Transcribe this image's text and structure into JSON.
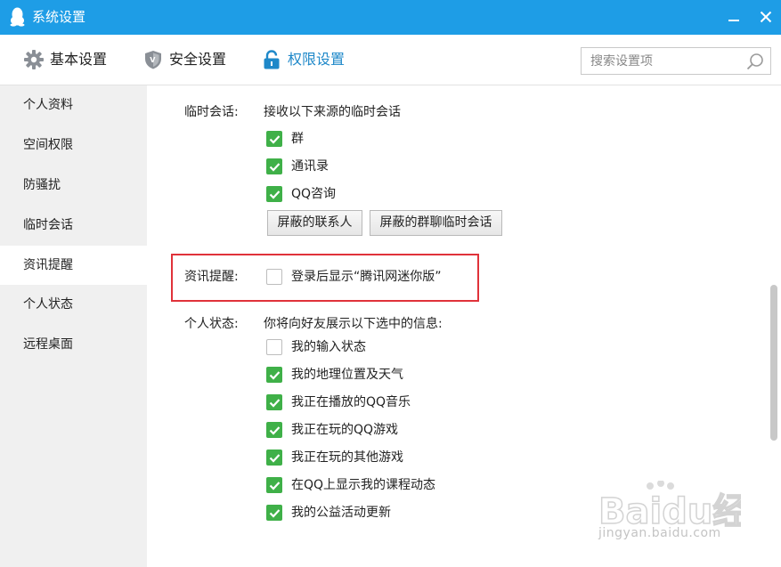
{
  "window": {
    "title": "系统设置",
    "minimize_glyph": "─",
    "close_glyph": "✕"
  },
  "tabs": [
    {
      "label": "基本设置",
      "icon": "gear-icon",
      "active": false
    },
    {
      "label": "安全设置",
      "icon": "shield-icon",
      "active": false
    },
    {
      "label": "权限设置",
      "icon": "lock-icon",
      "active": true
    }
  ],
  "search": {
    "placeholder": "搜索设置项",
    "value": ""
  },
  "sidebar": {
    "items": [
      {
        "label": "个人资料",
        "active": false
      },
      {
        "label": "空间权限",
        "active": false
      },
      {
        "label": "防骚扰",
        "active": false
      },
      {
        "label": "临时会话",
        "active": false
      },
      {
        "label": "资讯提醒",
        "active": true
      },
      {
        "label": "个人状态",
        "active": false
      },
      {
        "label": "远程桌面",
        "active": false
      }
    ]
  },
  "temp_chat": {
    "label": "临时会话:",
    "description": "接收以下来源的临时会话",
    "options": [
      {
        "label": "群",
        "checked": true
      },
      {
        "label": "通讯录",
        "checked": true
      },
      {
        "label": "QQ咨询",
        "checked": true
      }
    ],
    "buttons": {
      "blocked_contacts": "屏蔽的联系人",
      "blocked_group_chats": "屏蔽的群聊临时会话"
    }
  },
  "news_alert": {
    "label": "资讯提醒:",
    "option": {
      "label": "登录后显示“腾讯网迷你版”",
      "checked": false
    }
  },
  "personal_status": {
    "label": "个人状态:",
    "description": "你将向好友展示以下选中的信息:",
    "options": [
      {
        "label": "我的输入状态",
        "checked": false
      },
      {
        "label": "我的地理位置及天气",
        "checked": true
      },
      {
        "label": "我正在播放的QQ音乐",
        "checked": true
      },
      {
        "label": "我正在玩的QQ游戏",
        "checked": true
      },
      {
        "label": "我正在玩的其他游戏",
        "checked": true
      },
      {
        "label": "在QQ上显示我的课程动态",
        "checked": true
      },
      {
        "label": "我的公益活动更新",
        "checked": true
      }
    ]
  },
  "watermark": {
    "brand": "Baidu经验",
    "url": "jingyan.baidu.com"
  },
  "colors": {
    "titlebar": "#1e9de6",
    "active_tab_text": "#1e88c9",
    "checkbox_checked": "#3fb048",
    "highlight_border": "#e0323a",
    "sidebar_bg": "#f0f0f0"
  }
}
